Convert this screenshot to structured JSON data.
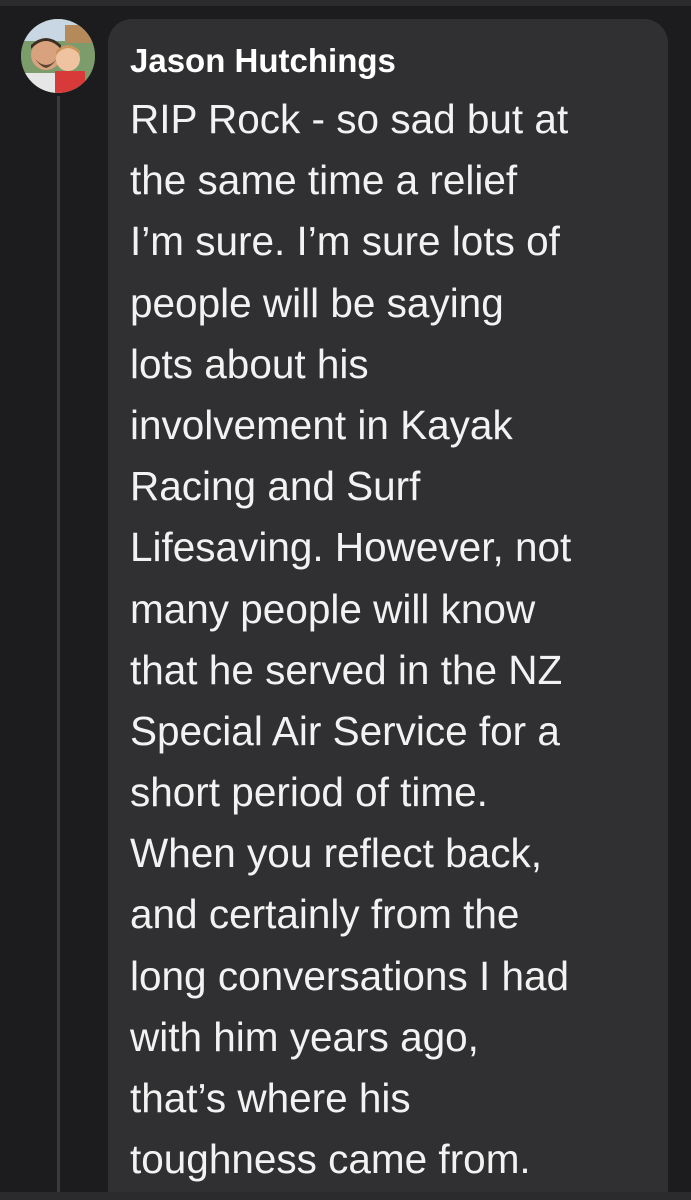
{
  "comment": {
    "author": "Jason Hutchings",
    "avatar_icon": "profile-photo-icon",
    "lines": [
      "RIP Rock - so sad but at",
      "the same time a relief",
      "I’m sure. I’m sure lots of",
      "people will be saying",
      "lots about his",
      "involvement in Kayak",
      "Racing and Surf",
      "Lifesaving. However, not",
      "many people will know",
      "that he served in the NZ",
      "Special Air Service for a",
      "short period of time.",
      "When you reflect back,",
      "and certainly from the",
      "long conversations I had",
      "with him years ago,",
      "that’s where his",
      "toughness came from."
    ]
  },
  "colors": {
    "background": "#1c1c1e",
    "bubble": "#303032",
    "text": "#f2f2f2",
    "thread_line": "#3a3a3c"
  }
}
